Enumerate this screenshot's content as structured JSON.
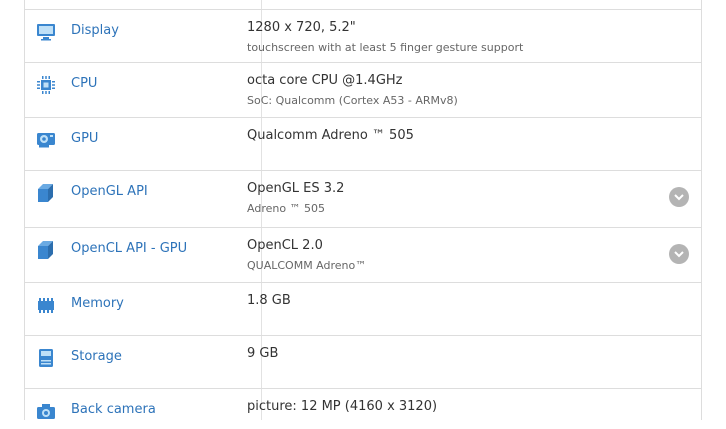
{
  "specs": [
    {
      "icon": "display-icon",
      "label": "Display",
      "value": "1280 x 720, 5.2\"",
      "sub": "touchscreen with at least 5 finger gesture support"
    },
    {
      "icon": "cpu-icon",
      "label": "CPU",
      "value": "octa core CPU @1.4GHz",
      "sub": "SoC: Qualcomm (Cortex A53 - ARMv8)"
    },
    {
      "icon": "gpu-icon",
      "label": "GPU",
      "value": "Qualcomm Adreno ™ 505",
      "sub": ""
    },
    {
      "icon": "opengl-icon",
      "label": "OpenGL API",
      "value": "OpenGL ES 3.2",
      "sub": "Adreno ™ 505",
      "expandable": true
    },
    {
      "icon": "opencl-icon",
      "label": "OpenCL API - GPU",
      "value": "OpenCL 2.0",
      "sub": "QUALCOMM Adreno™",
      "expandable": true
    },
    {
      "icon": "memory-icon",
      "label": "Memory",
      "value": "1.8 GB",
      "sub": ""
    },
    {
      "icon": "storage-icon",
      "label": "Storage",
      "value": "9 GB",
      "sub": ""
    },
    {
      "icon": "camera-icon",
      "label": "Back camera",
      "value": "picture: 12 MP (4160 x 3120)",
      "sub": ""
    }
  ],
  "colors": {
    "label": "#2d73b9",
    "icon": "#3a86cf",
    "expand": "#b4b4b4",
    "border": "#dddddd"
  }
}
